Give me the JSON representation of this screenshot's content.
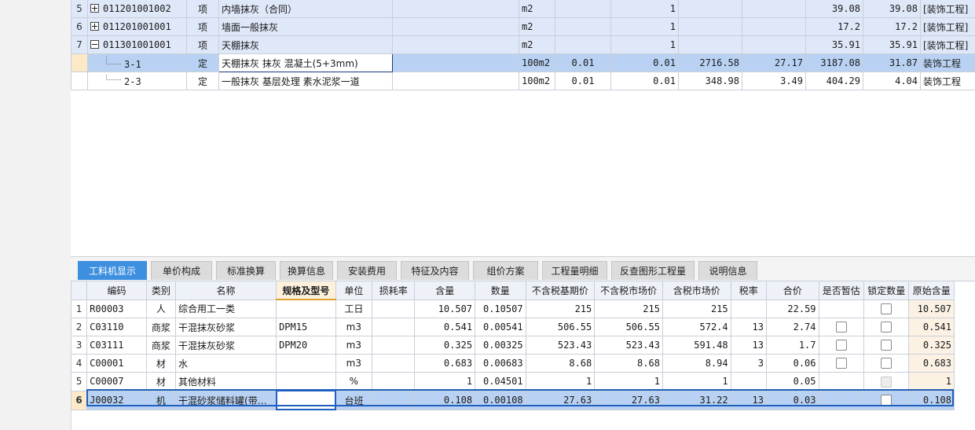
{
  "top_rows": [
    {
      "row": "5",
      "expander": "plus",
      "code": "011201001002",
      "type": "项",
      "name": "内墙抹灰（合同）",
      "spec": "",
      "unit": "m2",
      "c1": "",
      "qty": "1",
      "c3": "",
      "c4": "",
      "unit_price": "39.08",
      "total": "39.08",
      "fee": "[装饰工程]",
      "kind": "parent"
    },
    {
      "row": "6",
      "expander": "plus",
      "code": "011201001001",
      "type": "项",
      "name": "墙面一般抹灰",
      "spec": "",
      "unit": "m2",
      "c1": "",
      "qty": "1",
      "c3": "",
      "c4": "",
      "unit_price": "17.2",
      "total": "17.2",
      "fee": "[装饰工程]",
      "kind": "parent"
    },
    {
      "row": "7",
      "expander": "minus",
      "code": "011301001001",
      "type": "项",
      "name": "天棚抹灰",
      "spec": "",
      "unit": "m2",
      "c1": "",
      "qty": "1",
      "c3": "",
      "c4": "",
      "unit_price": "35.91",
      "total": "35.91",
      "fee": "[装饰工程]",
      "kind": "parent"
    },
    {
      "row": "",
      "expander": "",
      "code": "3-1",
      "type": "定",
      "name": "天棚抹灰 抹灰 混凝土(5+3mm)",
      "spec": "",
      "unit": "100m2",
      "c1": "0.01",
      "qty": "0.01",
      "c3": "2716.58",
      "c4": "27.17",
      "unit_price": "3187.08",
      "total": "31.87",
      "fee": "装饰工程",
      "kind": "selected"
    },
    {
      "row": "",
      "expander": "",
      "code": "2-3",
      "type": "定",
      "name": "一般抹灰 基层处理 素水泥浆一道",
      "spec": "",
      "unit": "100m2",
      "c1": "0.01",
      "qty": "0.01",
      "c3": "348.98",
      "c4": "3.49",
      "unit_price": "404.29",
      "total": "4.04",
      "fee": "装饰工程",
      "kind": "child"
    }
  ],
  "tabs": [
    "工料机显示",
    "单价构成",
    "标准换算",
    "换算信息",
    "安装费用",
    "特征及内容",
    "组价方案",
    "工程量明细",
    "反查图形工程量",
    "说明信息"
  ],
  "active_tab": "工料机显示",
  "columns": [
    "编码",
    "类别",
    "名称",
    "规格及型号",
    "单位",
    "损耗率",
    "含量",
    "数量",
    "不含税基期价",
    "不含税市场价",
    "含税市场价",
    "税率",
    "合价",
    "是否暂估",
    "锁定数量",
    "原始含量"
  ],
  "materials": [
    {
      "row": "1",
      "code": "R00003",
      "cat": "人",
      "name": "综合用工一类",
      "spec": "",
      "unit": "工日",
      "loss": "",
      "content": "10.507",
      "qty": "0.10507",
      "base": "215",
      "market": "215",
      "taxed": "215",
      "tax": "",
      "total": "22.59",
      "est": "none",
      "lock": "box",
      "orig": "10.507"
    },
    {
      "row": "2",
      "code": "C03110",
      "cat": "商浆",
      "name": "干混抹灰砂浆",
      "spec": "DPM15",
      "unit": "m3",
      "loss": "",
      "content": "0.541",
      "qty": "0.00541",
      "base": "506.55",
      "market": "506.55",
      "taxed": "572.4",
      "tax": "13",
      "total": "2.74",
      "est": "box",
      "lock": "box",
      "orig": "0.541"
    },
    {
      "row": "3",
      "code": "C03111",
      "cat": "商浆",
      "name": "干混抹灰砂浆",
      "spec": "DPM20",
      "unit": "m3",
      "loss": "",
      "content": "0.325",
      "qty": "0.00325",
      "base": "523.43",
      "market": "523.43",
      "taxed": "591.48",
      "tax": "13",
      "total": "1.7",
      "est": "box",
      "lock": "box",
      "orig": "0.325"
    },
    {
      "row": "4",
      "code": "C00001",
      "cat": "材",
      "name": "水",
      "spec": "",
      "unit": "m3",
      "loss": "",
      "content": "0.683",
      "qty": "0.00683",
      "base": "8.68",
      "market": "8.68",
      "taxed": "8.94",
      "tax": "3",
      "total": "0.06",
      "est": "box",
      "lock": "box",
      "orig": "0.683"
    },
    {
      "row": "5",
      "code": "C00007",
      "cat": "材",
      "name": "其他材料",
      "spec": "",
      "unit": "%",
      "loss": "",
      "content": "1",
      "qty": "0.04501",
      "base": "1",
      "market": "1",
      "taxed": "1",
      "tax": "",
      "total": "0.05",
      "est": "none",
      "lock": "disabled",
      "orig": "1"
    },
    {
      "row": "6",
      "code": "J00032",
      "cat": "机",
      "name": "干混砂浆储料罐(带…",
      "spec": "",
      "unit": "台班",
      "loss": "",
      "content": "0.108",
      "qty": "0.00108",
      "base": "27.63",
      "market": "27.63",
      "taxed": "31.22",
      "tax": "13",
      "total": "0.03",
      "est": "none",
      "lock": "box",
      "orig": "0.108"
    }
  ],
  "selected_material_row": "6"
}
